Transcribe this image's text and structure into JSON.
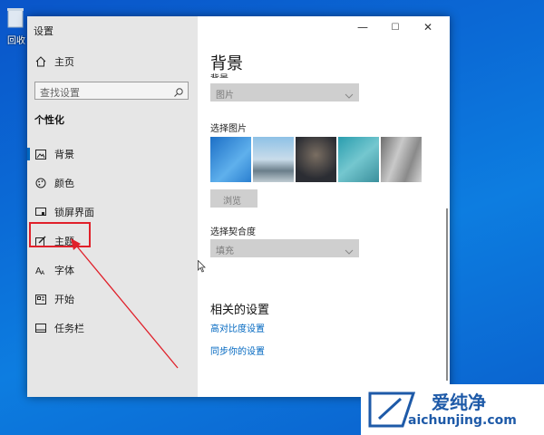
{
  "desktop": {
    "recycle_label": "回收"
  },
  "window": {
    "title": "设置",
    "controls": {
      "minimize": "—",
      "maximize": "☐",
      "close": "✕"
    }
  },
  "sidebar": {
    "home": "主页",
    "search_placeholder": "查找设置",
    "section_title": "个性化",
    "items": [
      {
        "label": "背景",
        "icon": "picture-icon"
      },
      {
        "label": "颜色",
        "icon": "palette-icon"
      },
      {
        "label": "锁屏界面",
        "icon": "lock-screen-icon"
      },
      {
        "label": "主题",
        "icon": "theme-brush-icon"
      },
      {
        "label": "字体",
        "icon": "font-icon"
      },
      {
        "label": "开始",
        "icon": "start-icon"
      },
      {
        "label": "任务栏",
        "icon": "taskbar-icon"
      }
    ]
  },
  "main": {
    "heading": "背景",
    "background_label": "背景",
    "background_value": "图片",
    "choose_picture_label": "选择图片",
    "browse_label": "浏览",
    "fit_label": "选择契合度",
    "fit_value": "填充",
    "related_heading": "相关的设置",
    "links": [
      "高对比度设置",
      "同步你的设置"
    ]
  },
  "watermark": {
    "brand": "爱纯净",
    "url": "aichunjing.com"
  },
  "colors": {
    "accent": "#0067c0",
    "highlight": "#e0202a",
    "desktop": "#0b6bd6"
  }
}
